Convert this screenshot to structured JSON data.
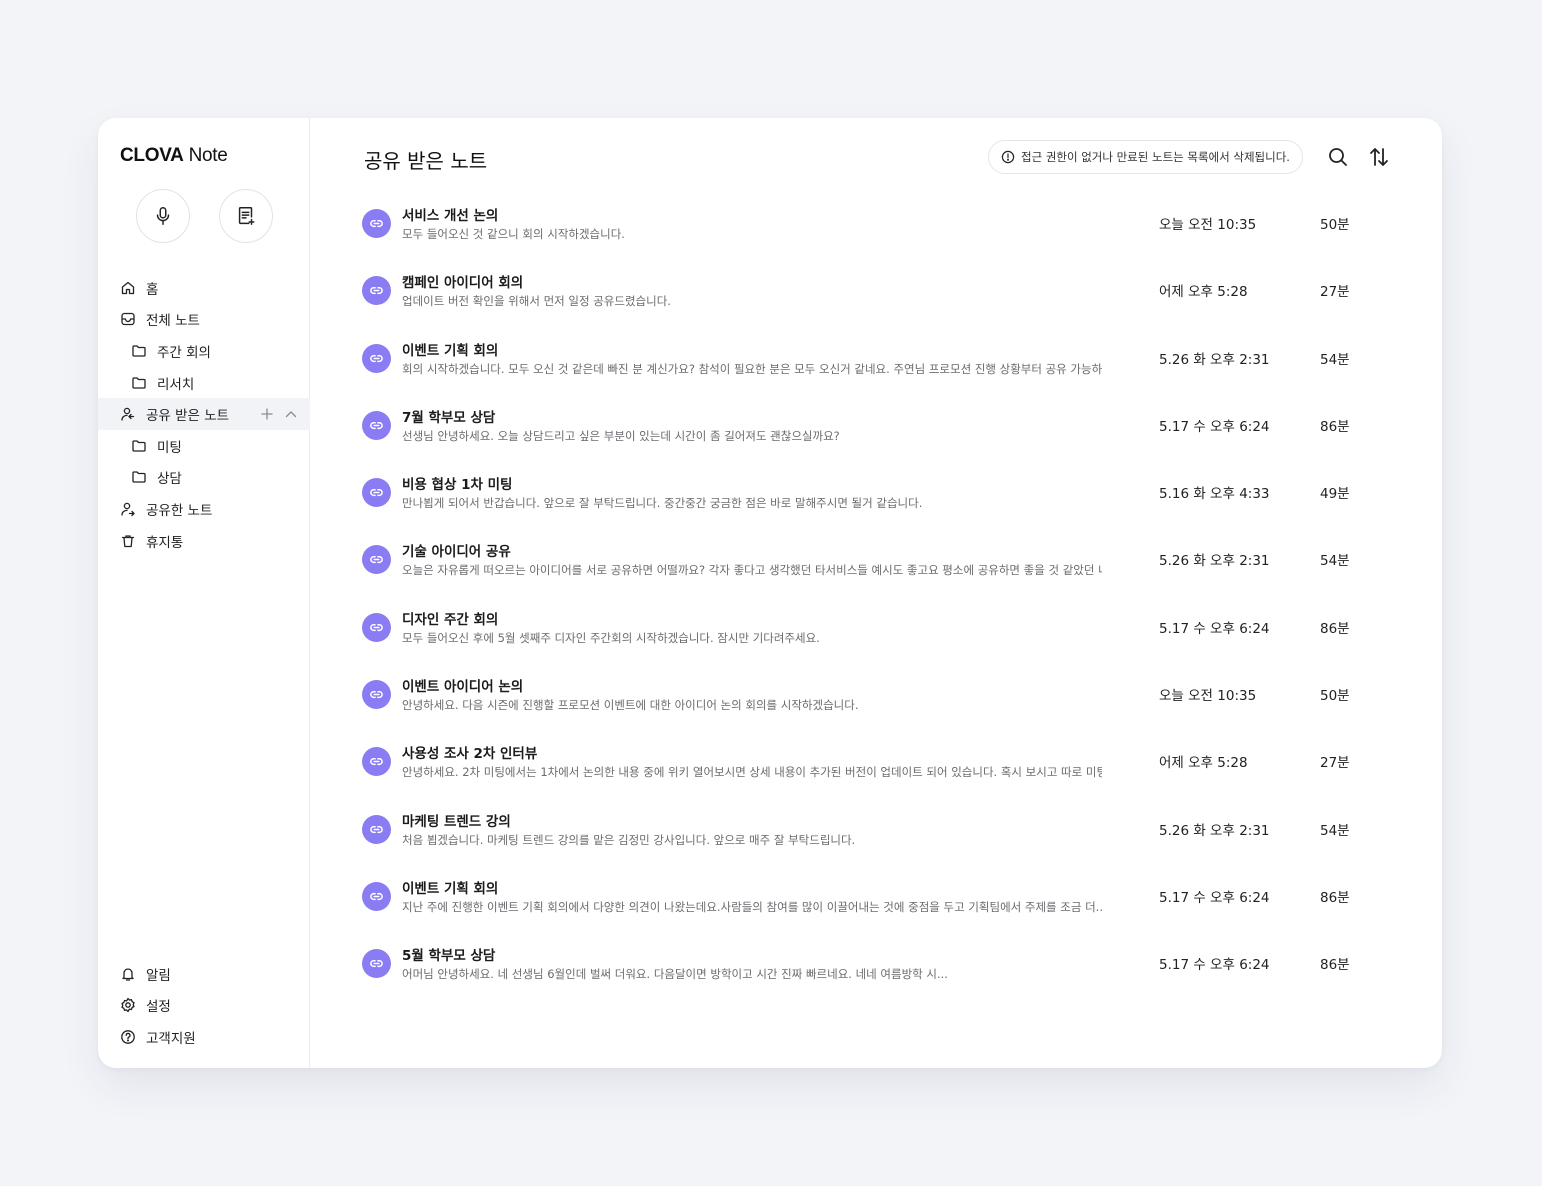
{
  "app": {
    "logo_bold": "CLOVA",
    "logo_light": " Note"
  },
  "sidebar": {
    "record_button_icon": "microphone-icon",
    "new_note_button_icon": "note-add-icon",
    "items": [
      {
        "label": "홈",
        "icon": "home-icon"
      },
      {
        "label": "전체 노트",
        "icon": "inbox-icon"
      },
      {
        "label": "주간 회의",
        "icon": "folder-icon"
      },
      {
        "label": "리서치",
        "icon": "folder-icon"
      },
      {
        "label": "공유 받은 노트",
        "icon": "shared-received-icon"
      },
      {
        "label": "미팅",
        "icon": "folder-icon"
      },
      {
        "label": "상담",
        "icon": "folder-icon"
      },
      {
        "label": "공유한 노트",
        "icon": "shared-sent-icon"
      },
      {
        "label": "휴지통",
        "icon": "trash-icon"
      }
    ],
    "bottom_items": [
      {
        "label": "알림",
        "icon": "bell-icon"
      },
      {
        "label": "설정",
        "icon": "gear-icon"
      },
      {
        "label": "고객지원",
        "icon": "help-icon"
      }
    ]
  },
  "main": {
    "title": "공유 받은 노트",
    "notice": "접근 권한이 없거나 만료된 노트는 목록에서 삭제됩니다.",
    "accent_color": "#8a7cf2",
    "notes": [
      {
        "title": "서비스 개선 논의",
        "preview": "모두 들어오신 것 같으니 회의 시작하겠습니다.",
        "date": "오늘 오전 10:35",
        "duration": "50분"
      },
      {
        "title": "캠페인 아이디어 회의",
        "preview": "업데이트 버전 확인을 위해서 먼저 일정 공유드렸습니다.",
        "date": "어제 오후 5:28",
        "duration": "27분"
      },
      {
        "title": "이벤트 기획 회의",
        "preview": "회의 시작하겠습니다. 모두 오신 것 같은데 빠진 분 계신가요? 참석이 필요한 분은 모두 오신거 같네요. 주연님 프로모션 진행 상황부터 공유 가능하...",
        "date": "5.26 화 오후 2:31",
        "duration": "54분"
      },
      {
        "title": "7월 학부모 상담",
        "preview": "선생님 안녕하세요. 오늘 상담드리고 싶은 부분이 있는데 시간이 좀 길어져도 괜찮으실까요?",
        "date": "5.17 수 오후 6:24",
        "duration": "86분"
      },
      {
        "title": "비용 협상 1차 미팅",
        "preview": "만나뵙게 되어서 반갑습니다. 앞으로 잘 부탁드립니다. 중간중간 궁금한 점은 바로 말해주시면 될거 같습니다.",
        "date": "5.16 화 오후 4:33",
        "duration": "49분"
      },
      {
        "title": "기술 아이디어 공유",
        "preview": "오늘은 자유롭게 떠오르는 아이디어를 서로 공유하면 어떨까요? 각자 좋다고 생각했던 타서비스들 예시도 좋고요 평소에 공유하면 좋을 것 같았던 내...",
        "date": "5.26 화 오후 2:31",
        "duration": "54분"
      },
      {
        "title": "디자인 주간 회의",
        "preview": "모두 들어오신 후에 5월 셋째주 디자인 주간회의 시작하겠습니다. 잠시만 기다려주세요.",
        "date": "5.17 수 오후 6:24",
        "duration": "86분"
      },
      {
        "title": "이벤트 아이디어 논의",
        "preview": "안녕하세요. 다음 시즌에 진행할 프로모션 이벤트에 대한 아이디어 논의 회의를 시작하겠습니다.",
        "date": "오늘 오전 10:35",
        "duration": "50분"
      },
      {
        "title": "사용성 조사 2차 인터뷰",
        "preview": "안녕하세요. 2차 미팅에서는 1차에서 논의한 내용 중에 위키 열어보시면 상세 내용이 추가된 버전이 업데이트 되어 있습니다. 혹시 보시고 따로 미팅...",
        "date": "어제 오후 5:28",
        "duration": "27분"
      },
      {
        "title": "마케팅 트렌드 강의",
        "preview": "처음 뵙겠습니다. 마케팅 트렌드 강의를 맡은 김정민 강사입니다. 앞으로 매주 잘 부탁드립니다.",
        "date": "5.26 화 오후 2:31",
        "duration": "54분"
      },
      {
        "title": "이벤트 기획 회의",
        "preview": "지난 주에 진행한 이벤트 기획 회의에서 다양한 의견이 나왔는데요.사람들의 참여를 많이 이끌어내는 것에 중점을 두고 기획팀에서 주제를 조금 더...",
        "date": "5.17 수 오후 6:24",
        "duration": "86분"
      },
      {
        "title": "5월 학부모 상담",
        "preview": "어머님 안녕하세요. 네 선생님 6월인데 벌써 더워요. 다음달이면 방학이고 시간 진짜 빠르네요. 네네 여름방학 시...",
        "date": "5.17 수 오후 6:24",
        "duration": "86분"
      }
    ]
  }
}
